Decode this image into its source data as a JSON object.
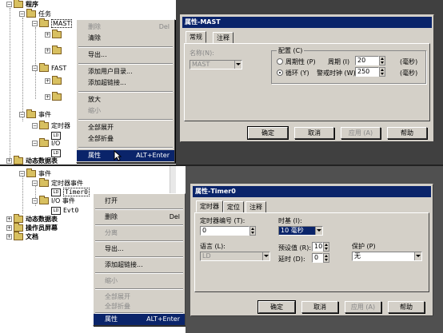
{
  "top": {
    "tree": {
      "program": "程序",
      "task": "任务",
      "mast": "MAST",
      "fast": "FAST",
      "event": "事件",
      "timer": "定时器",
      "io": "I/O",
      "dynamic": "动态数据表"
    },
    "menu": {
      "delete": "删除",
      "delete_acc": "Del",
      "clear": "清除",
      "export": "导出...",
      "add_user_dir": "添加用户目录...",
      "add_link": "添加超链接...",
      "zoom_in": "放大",
      "zoom_out": "缩小",
      "expand_all": "全部展开",
      "collapse_all": "全部折叠",
      "properties": "属性",
      "properties_acc": "ALT+Enter"
    },
    "dialog": {
      "title": "属性-MAST",
      "tabs": [
        "常规",
        "注释"
      ],
      "name_label": "名称(N):",
      "name_value": "MAST",
      "group_label": "配置 (C)",
      "periodic_label": "周期性 (P)",
      "period_label": "周期 (I)",
      "period_value": "20",
      "period_unit": "(毫秒)",
      "cyclic_label": "循环 (Y)",
      "watchdog_label": "警戒时钟 (W)",
      "watchdog_value": "250",
      "watchdog_unit": "(毫秒)",
      "ok": "确定",
      "cancel": "取消",
      "apply": "应用 (A)",
      "help": "帮助"
    }
  },
  "bottom": {
    "tree": {
      "event": "事件",
      "timer_event": "定时器事件",
      "timer0": "Timer0",
      "io_event": "I/O 事件",
      "evt0": "Evt0",
      "dynamic": "动态数据表",
      "operator": "操作员屏幕",
      "docs": "文档"
    },
    "menu": {
      "open": "打开",
      "delete": "删除",
      "delete_acc": "Del",
      "separate": "分离",
      "export": "导出...",
      "add_link": "添加超链接...",
      "zoom_out": "缩小",
      "expand_all": "全部展开",
      "collapse_all": "全部折叠",
      "properties": "属性",
      "properties_acc": "ALT+Enter"
    },
    "dialog": {
      "title": "属性-Timer0",
      "tabs": [
        "定时器",
        "定位",
        "注释"
      ],
      "timer_num_label": "定时器编号 (T):",
      "timer_num_value": "0",
      "timebase_label": "时基 (I):",
      "timebase_value": "10 毫秒",
      "language_label": "语言 (L):",
      "language_value": "LD",
      "preset_label": "预设值 (R):",
      "preset_value": "10",
      "delay_label": "延时 (D):",
      "delay_value": "0",
      "protect_label": "保护 (P)",
      "protect_value": "无",
      "ok": "确定",
      "cancel": "取消",
      "apply": "应用 (A)",
      "help": "帮助"
    }
  }
}
